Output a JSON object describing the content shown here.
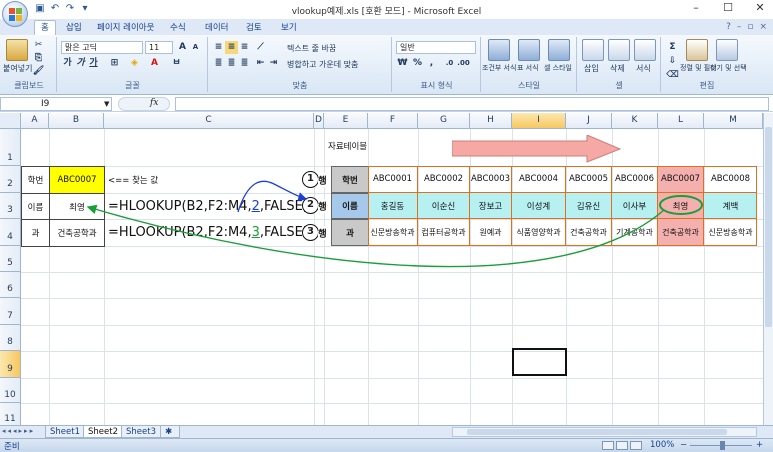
{
  "window": {
    "title": "vlookup예제.xls  [호환 모드] - Microsoft Excel",
    "controls": [
      "–",
      "☐",
      "✕"
    ]
  },
  "ribbon_tabs": [
    "홈",
    "삽입",
    "페이지 레이아웃",
    "수식",
    "데이터",
    "검토",
    "보기"
  ],
  "ribbon": {
    "paste": "붙여넣기",
    "font_name": "맑은 고딕",
    "font_size": "11",
    "bold": "가",
    "italic": "가",
    "underline": "가",
    "wrap_text": "텍스트 줄 바꿈",
    "merge_center": "병합하고 가운데 맞춤",
    "number_format": "일반",
    "currency": "₩",
    "percent": "%",
    "comma": ",",
    "conditional": "조건부 서식",
    "table_format": "표 서식",
    "cell_style": "셀 스타일",
    "insert": "삽입",
    "delete": "삭제",
    "format": "서식",
    "sort_filter": "정렬 및 필터",
    "find_select": "찾기 및 선택",
    "groups": {
      "clipboard": "클립보드",
      "font": "글꼴",
      "alignment": "맞춤",
      "number": "표시 형식",
      "style": "스타일",
      "cells": "셀",
      "editing": "편집"
    }
  },
  "formula_bar": {
    "name_box": "I9",
    "fx": "fx",
    "content": ""
  },
  "columns": [
    "A",
    "B",
    "C",
    "D",
    "E",
    "F",
    "G",
    "H",
    "I",
    "J",
    "K",
    "L",
    "M"
  ],
  "rows": [
    "1",
    "2",
    "3",
    "4",
    "5",
    "6",
    "7",
    "8",
    "9",
    "10",
    "11"
  ],
  "cells": {
    "E1": "자료테이블",
    "A2": "학번",
    "B2": "ABC0007",
    "C2": "<== 찾는 값",
    "A3": "이름",
    "B3": "최영",
    "C3": "=HLOOKUP(B2,F2:M4,",
    "C3_index": "2",
    "C3_tail": ",FALSE)",
    "A4": "과",
    "B4": "건축공학과",
    "C4": "=HLOOKUP(B2,F2:M4,",
    "C4_index": "3",
    "C4_tail": ",FALSE)",
    "E2": "학번",
    "E3": "이름",
    "E4": "과",
    "row_markers": [
      "1",
      "2",
      "3"
    ],
    "row_marker_suffix": "행"
  },
  "table": {
    "ids": [
      "ABC0001",
      "ABC0002",
      "ABC0003",
      "ABC0004",
      "ABC0005",
      "ABC0006",
      "ABC0007",
      "ABC0008"
    ],
    "names": [
      "홍길동",
      "이순신",
      "장보고",
      "이성계",
      "김유신",
      "이사부",
      "최영",
      "계백"
    ],
    "depts": [
      "신문방송학과",
      "컴퓨터공학과",
      "원예과",
      "식품영양학과",
      "건축공학과",
      "기계공학과",
      "건축공학과",
      "신문방송학과"
    ]
  },
  "sheet_tabs": [
    "Sheet1",
    "Sheet2",
    "Sheet3"
  ],
  "status": {
    "ready": "준비",
    "zoom": "100%",
    "minus": "−",
    "plus": "+"
  },
  "colors": {
    "lookup_value": "#ffff00",
    "header_gray": "#c9c9c9",
    "result_row": "#b7f0f0",
    "match_col": "#f4b0ae",
    "table_border": "#e0701e",
    "arrow_blue": "#1f3fd6",
    "arrow_green": "#1a9e3a",
    "banner_arrow": "#f5a8a4"
  }
}
